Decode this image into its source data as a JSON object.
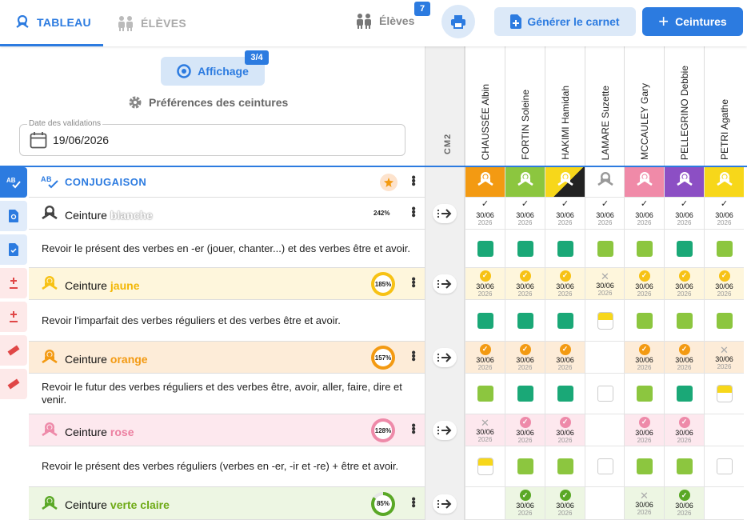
{
  "topbar": {
    "tab_tableau": "TABLEAU",
    "tab_eleves": "ÉLÈVES",
    "eleves_label": "Élèves",
    "eleves_count": "7",
    "carnet_label": "Générer le carnet",
    "ceintures_label": "Ceintures"
  },
  "toolbar": {
    "affichage_label": "Affichage",
    "affichage_badge": "3/4",
    "prefs_label": "Préférences des ceintures",
    "date_label": "Date des validations",
    "date_value": "19/06/2026"
  },
  "class_label": "CM2",
  "students": [
    "CHAUSSÉE Albin",
    "FORTIN Soleine",
    "HAKIMI Hamidah",
    "LAMARE Suzette",
    "MCCAULEY Gary",
    "PELLEGRINO Debbie",
    "PETRI Agathe"
  ],
  "colors": {
    "accent": "#2c7be0",
    "blanche": "#ffffff",
    "jaune": "#f7d71a",
    "orange": "#f39a12",
    "rose": "#f08aa8",
    "verte_claire": "#8cc63f",
    "violet": "#8c4fc4",
    "noir": "#222222",
    "vert": "#1aa877"
  },
  "header_belts": [
    "orange",
    "verte-claire",
    "noir-jaune",
    "blanche",
    "rose",
    "violet",
    "jaune"
  ],
  "rows": [
    {
      "type": "subject",
      "title": "CONJUGAISON"
    },
    {
      "type": "belt",
      "prefix": "Ceinture",
      "name": "blanche",
      "pct": "242%",
      "color": "#cccccc",
      "fill": 1,
      "cells": [
        {
          "k": "check",
          "d": "30/06",
          "y": "2026"
        },
        {
          "k": "check",
          "d": "30/06",
          "y": "2026"
        },
        {
          "k": "check",
          "d": "30/06",
          "y": "2026"
        },
        {
          "k": "check",
          "d": "30/06",
          "y": "2026"
        },
        {
          "k": "check",
          "d": "30/06",
          "y": "2026"
        },
        {
          "k": "check",
          "d": "30/06",
          "y": "2026"
        },
        {
          "k": "check",
          "d": "30/06",
          "y": "2026"
        }
      ]
    },
    {
      "type": "desc",
      "text": "Revoir le présent des verbes en -er (jouer, chanter...) et des verbes être et avoir.",
      "cells": [
        "green",
        "green",
        "green",
        "lime",
        "lime",
        "green",
        "lime"
      ]
    },
    {
      "type": "belt",
      "prefix": "Ceinture",
      "name": "jaune",
      "pct": "185%",
      "color": "#f7d71a",
      "fill": 1,
      "cells": [
        {
          "k": "circle",
          "d": "30/06",
          "y": "2026"
        },
        {
          "k": "circle",
          "d": "30/06",
          "y": "2026"
        },
        {
          "k": "circle",
          "d": "30/06",
          "y": "2026"
        },
        {
          "k": "cross",
          "d": "30/06",
          "y": "2026"
        },
        {
          "k": "circle",
          "d": "30/06",
          "y": "2026"
        },
        {
          "k": "circle",
          "d": "30/06",
          "y": "2026"
        },
        {
          "k": "circle",
          "d": "30/06",
          "y": "2026"
        }
      ]
    },
    {
      "type": "desc",
      "text": "Revoir l'imparfait des verbes réguliers et des verbes être et avoir.",
      "cells": [
        "green",
        "green",
        "green",
        "half",
        "lime",
        "lime",
        "lime"
      ]
    },
    {
      "type": "belt",
      "prefix": "Ceinture",
      "name": "orange",
      "pct": "157%",
      "color": "#f39a12",
      "fill": 1,
      "cells": [
        {
          "k": "circle",
          "d": "30/06",
          "y": "2026"
        },
        {
          "k": "circle",
          "d": "30/06",
          "y": "2026"
        },
        {
          "k": "circle",
          "d": "30/06",
          "y": "2026"
        },
        {
          "k": "none"
        },
        {
          "k": "circle",
          "d": "30/06",
          "y": "2026"
        },
        {
          "k": "circle",
          "d": "30/06",
          "y": "2026"
        },
        {
          "k": "cross",
          "d": "30/06",
          "y": "2026"
        }
      ]
    },
    {
      "type": "desc",
      "text": "Revoir le futur des verbes réguliers et des verbes être, avoir, aller, faire, dire et venir.",
      "cells": [
        "lime",
        "green",
        "green",
        "empty",
        "lime",
        "green",
        "half"
      ]
    },
    {
      "type": "belt",
      "prefix": "Ceinture",
      "name": "rose",
      "pct": "128%",
      "color": "#f08aa8",
      "fill": 1,
      "cells": [
        {
          "k": "cross",
          "d": "30/06",
          "y": "2026"
        },
        {
          "k": "circle",
          "d": "30/06",
          "y": "2026"
        },
        {
          "k": "circle",
          "d": "30/06",
          "y": "2026"
        },
        {
          "k": "none"
        },
        {
          "k": "circle",
          "d": "30/06",
          "y": "2026"
        },
        {
          "k": "circle",
          "d": "30/06",
          "y": "2026"
        },
        {
          "k": "none"
        }
      ]
    },
    {
      "type": "desc",
      "text": "Revoir le présent des verbes réguliers (verbes en -er, -ir et -re) + être et avoir.",
      "cells": [
        "half",
        "lime",
        "lime",
        "empty",
        "lime",
        "lime",
        "empty"
      ]
    },
    {
      "type": "belt",
      "prefix": "Ceinture",
      "name": "verte claire",
      "pct": "85%",
      "color": "#8cc63f",
      "fill": 0.85,
      "cells": [
        {
          "k": "none"
        },
        {
          "k": "circle",
          "d": "30/06",
          "y": "2026"
        },
        {
          "k": "circle",
          "d": "30/06",
          "y": "2026"
        },
        {
          "k": "none"
        },
        {
          "k": "cross",
          "d": "30/06",
          "y": "2026"
        },
        {
          "k": "circle",
          "d": "30/06",
          "y": "2026"
        },
        {
          "k": "none"
        }
      ]
    }
  ]
}
